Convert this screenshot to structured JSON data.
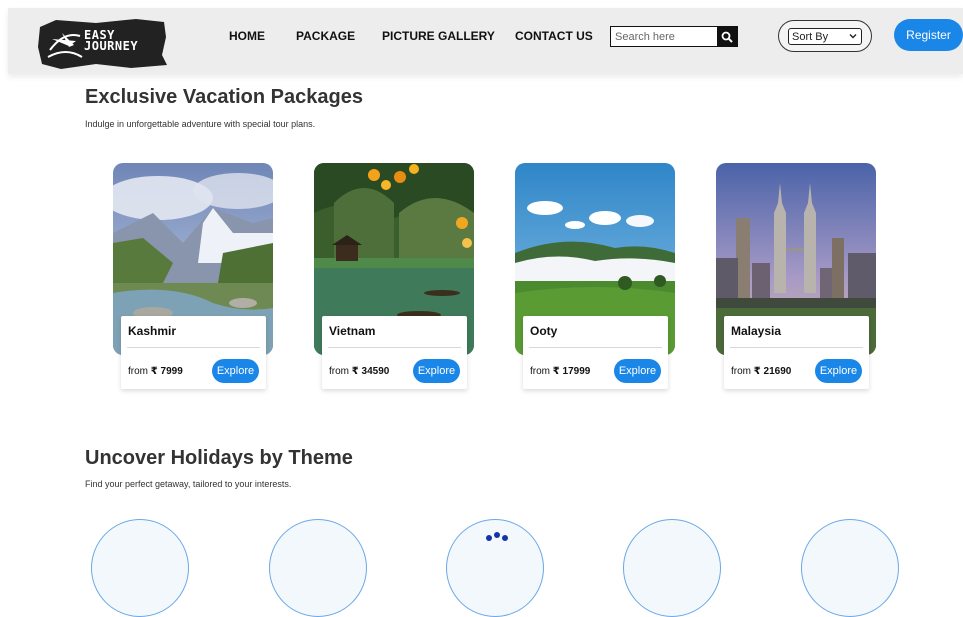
{
  "brand": {
    "line1": "EASY",
    "line2": "JOURNEY",
    "logo_color": "#222222"
  },
  "nav": {
    "home": "HOME",
    "package": "PACKAGE",
    "gallery": "PICTURE GALLERY",
    "contact": "CONTACT US"
  },
  "search": {
    "placeholder": "Search here",
    "icon": "search-icon"
  },
  "sort": {
    "selected": "Sort By",
    "icon": "chevron-down-icon"
  },
  "register": {
    "label": "Register",
    "color": "#1a86e8"
  },
  "packages": {
    "title": "Exclusive Vacation Packages",
    "subtitle": "Indulge in unforgettable adventure with special tour plans.",
    "items": [
      {
        "name": "Kashmir",
        "price_prefix": "from",
        "price": "₹ 7999",
        "button": "Explore"
      },
      {
        "name": "Vietnam",
        "price_prefix": "from",
        "price": "₹ 34590",
        "button": "Explore"
      },
      {
        "name": "Ooty",
        "price_prefix": "from",
        "price": "₹ 17999",
        "button": "Explore"
      },
      {
        "name": "Malaysia",
        "price_prefix": "from",
        "price": "₹ 21690",
        "button": "Explore"
      }
    ]
  },
  "themes": {
    "title": "Uncover Holidays by Theme",
    "subtitle": "Find your perfect getaway, tailored to your interests."
  }
}
